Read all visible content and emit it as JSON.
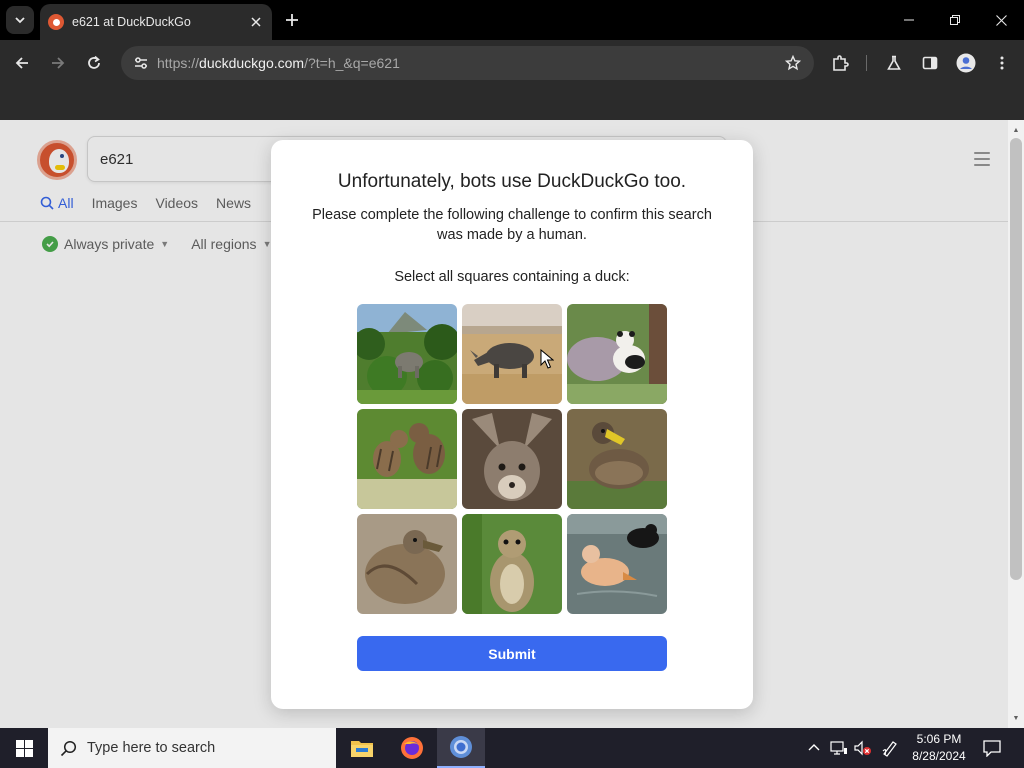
{
  "browser": {
    "tab_title": "e621 at DuckDuckGo",
    "url_prefix": "https://",
    "url_host": "duckduckgo.com",
    "url_rest": "/?t=h_&q=e621"
  },
  "ddg": {
    "search_value": "e621",
    "tabs": [
      "All",
      "Images",
      "Videos",
      "News"
    ],
    "filters": {
      "privacy": "Always private",
      "region": "All regions"
    }
  },
  "challenge": {
    "title": "Unfortunately, bots use DuckDuckGo too.",
    "subtitle": "Please complete the following challenge to confirm this search was made by a human.",
    "prompt": "Select all squares containing a duck:",
    "tiles": [
      {
        "subject": "elephant"
      },
      {
        "subject": "rhinoceros"
      },
      {
        "subject": "panda"
      },
      {
        "subject": "cats"
      },
      {
        "subject": "fox"
      },
      {
        "subject": "duck"
      },
      {
        "subject": "duck"
      },
      {
        "subject": "squirrel"
      },
      {
        "subject": "duck"
      }
    ],
    "submit_label": "Submit"
  },
  "taskbar": {
    "search_placeholder": "Type here to search",
    "time": "5:06 PM",
    "date": "8/28/2024"
  },
  "colors": {
    "ddg_accent": "#3969ef",
    "ddg_brand": "#de5833"
  }
}
